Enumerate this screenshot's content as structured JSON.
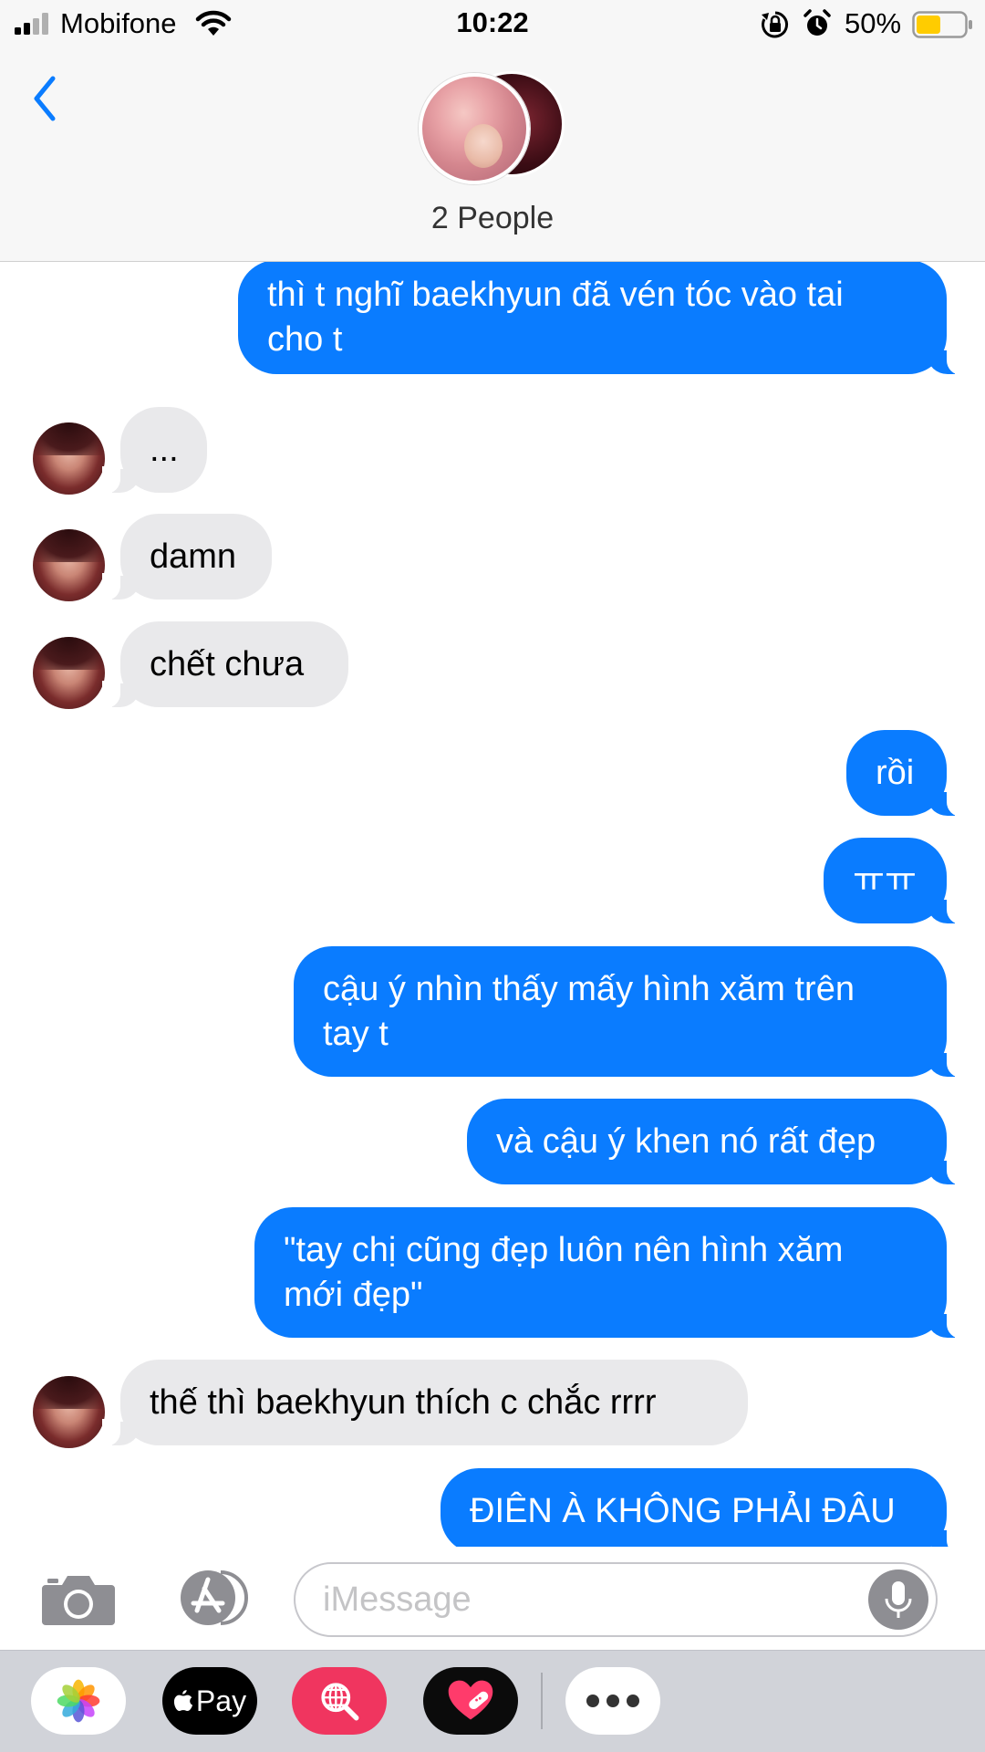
{
  "status_bar": {
    "carrier": "Mobifone",
    "time": "10:22",
    "battery_percent": "50%",
    "battery_level": 0.5,
    "battery_color": "#ffcc00",
    "icons": [
      "signal-icon",
      "wifi-icon",
      "orientation-lock-icon",
      "alarm-icon",
      "battery-icon"
    ]
  },
  "header": {
    "back_icon": "chevron-left-icon",
    "accent_color": "#0a7cff",
    "group_title": "2 People"
  },
  "messages": [
    {
      "direction": "outgoing",
      "text": "thì t nghĩ baekhyun đã vén tóc vào tai\ncho t"
    },
    {
      "direction": "incoming",
      "text": "..."
    },
    {
      "direction": "incoming",
      "text": "damn"
    },
    {
      "direction": "incoming",
      "text": "chết chưa"
    },
    {
      "direction": "outgoing",
      "text": "rồi"
    },
    {
      "direction": "outgoing",
      "text": "ㅠㅠ"
    },
    {
      "direction": "outgoing",
      "text": "cậu ý nhìn thấy mấy hình xăm trên\ntay t"
    },
    {
      "direction": "outgoing",
      "text": "và cậu ý khen nó rất đẹp"
    },
    {
      "direction": "outgoing",
      "text": "\"tay chị cũng đẹp luôn nên hình xăm\nmới đẹp\""
    },
    {
      "direction": "incoming",
      "text": "thế thì baekhyun thích c chắc rrrr"
    },
    {
      "direction": "outgoing",
      "text": "ĐIÊN À KHÔNG PHẢI ĐÂU"
    }
  ],
  "input_bar": {
    "placeholder": "iMessage",
    "value": "",
    "icons": [
      "camera-icon",
      "app-store-icon",
      "microphone-icon"
    ]
  },
  "app_drawer": {
    "apps": [
      {
        "name": "photos",
        "icon": "photos-icon"
      },
      {
        "name": "apple-pay",
        "label": "Pay",
        "icon": "apple-pay-icon"
      },
      {
        "name": "image-search",
        "icon": "globe-search-icon"
      },
      {
        "name": "stickers",
        "icon": "heart-sticker-icon"
      },
      {
        "name": "more",
        "icon": "more-icon"
      }
    ]
  }
}
